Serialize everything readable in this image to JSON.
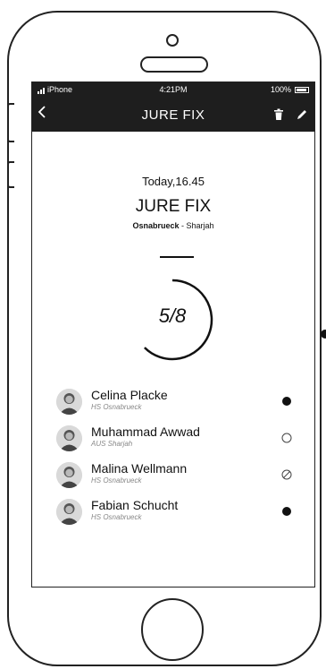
{
  "status_bar": {
    "carrier": "iPhone",
    "time": "4:21PM",
    "battery": "100%"
  },
  "nav": {
    "back_icon": "chevron-left-icon",
    "title": "JURE FIX",
    "actions": [
      "trash-icon",
      "pencil-icon"
    ]
  },
  "match": {
    "datetime": "Today,16.45",
    "title": "JURE FIX",
    "team_home": "Osnabrueck",
    "separator": " - ",
    "team_away": "Sharjah",
    "score": "5/8",
    "progress_fraction": 0.625
  },
  "players": [
    {
      "name": "Celina Placke",
      "org": "HS Osnabrueck",
      "status": "filled-dot"
    },
    {
      "name": "Muhammad Awwad",
      "org": "AUS Sharjah",
      "status": "empty-circle"
    },
    {
      "name": "Malina Wellmann",
      "org": "HS Osnabrueck",
      "status": "unavailable"
    },
    {
      "name": "Fabian Schucht",
      "org": "HS Osnabrueck",
      "status": "filled-dot"
    }
  ],
  "colors": {
    "bar_background": "#1e1e1e",
    "text": "#111111",
    "subtext": "#888888"
  }
}
